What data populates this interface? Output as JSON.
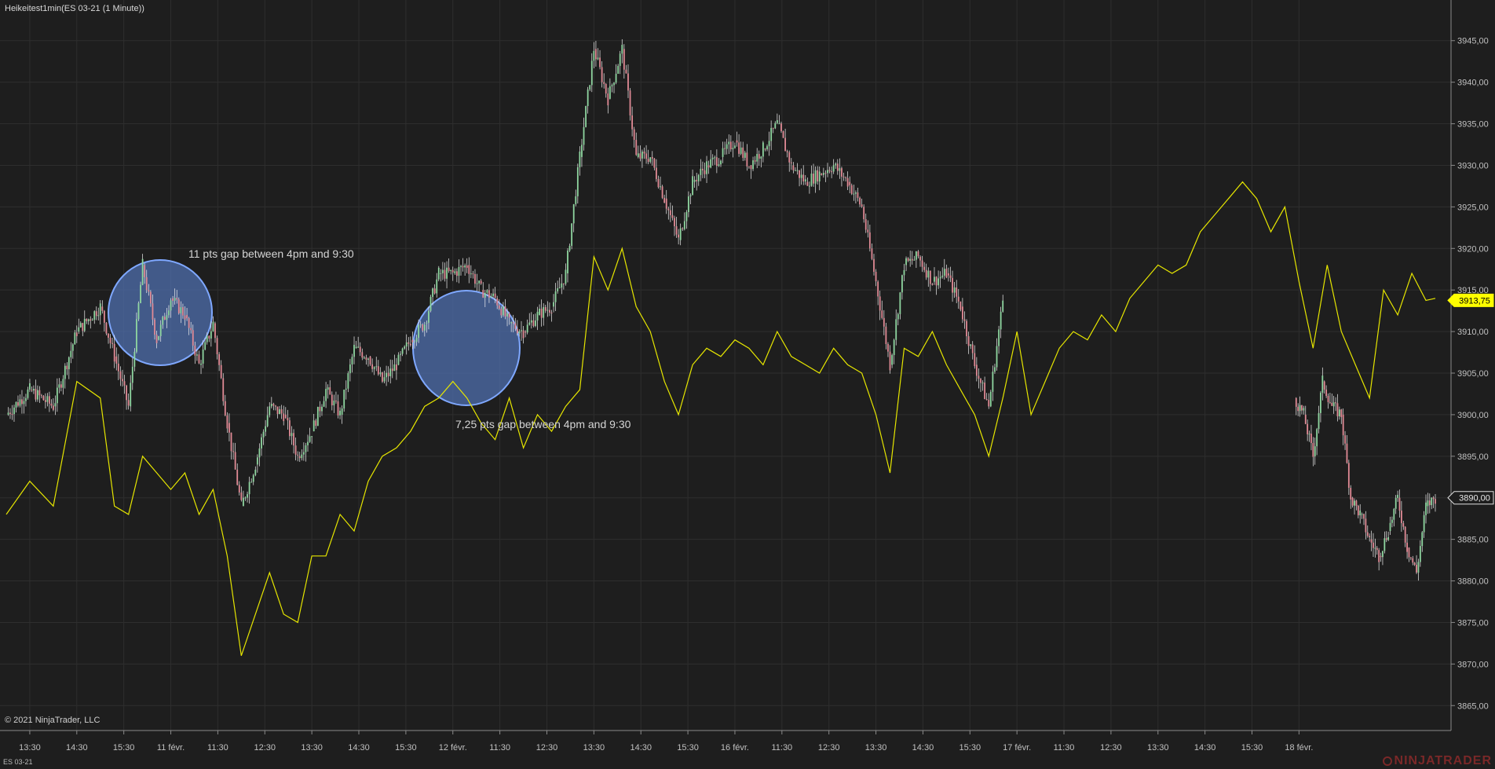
{
  "window": {
    "title": "Heikeitest1min(ES 03-21 (1 Minute))",
    "copyright": "© 2021 NinjaTrader, LLC",
    "instrument": "ES 03-21",
    "brand": "NINJATRADER",
    "brand_logo_icon": "ninjatrader-logo-icon"
  },
  "annotations": [
    "11 pts gap between 4pm and 9:30",
    "7,25 pts gap between 4pm and 9:30"
  ],
  "colors": {
    "background": "#1e1e1e",
    "grid": "#2e2e2e",
    "candle_up": "#8fd6a0",
    "candle_down": "#e08a95",
    "wick": "#f0f0f0",
    "yellow_series": "#e6e600",
    "circle_fill": "#4f6fae",
    "circle_stroke": "#7fa8ff",
    "current_price_bg": "#ffff00",
    "last_price_bg": "#1e1e1e"
  },
  "chart_data": {
    "type": "line",
    "title": "Heikeitest1min(ES 03-21 (1 Minute))",
    "ylim": [
      3862,
      3948
    ],
    "y_ticks": [
      "3945,00",
      "3940,00",
      "3935,00",
      "3930,00",
      "3925,00",
      "3920,00",
      "3915,00",
      "3910,00",
      "3905,00",
      "3900,00",
      "3895,00",
      "3890,00",
      "3885,00",
      "3880,00",
      "3875,00",
      "3870,00",
      "3865,00"
    ],
    "y_tick_values": [
      3945,
      3940,
      3935,
      3930,
      3925,
      3920,
      3915,
      3910,
      3905,
      3900,
      3895,
      3890,
      3885,
      3880,
      3875,
      3870,
      3865
    ],
    "x_ticks": [
      "13:30",
      "14:30",
      "15:30",
      "11 févr.",
      "11:30",
      "12:30",
      "13:30",
      "14:30",
      "15:30",
      "12 févr.",
      "11:30",
      "12:30",
      "13:30",
      "14:30",
      "15:30",
      "16 févr.",
      "11:30",
      "12:30",
      "13:30",
      "14:30",
      "15:30",
      "17 févr.",
      "11:30",
      "12:30",
      "13:30",
      "14:30",
      "15:30",
      "18 févr."
    ],
    "x_tick_index": [
      0.5,
      1.5,
      2.5,
      3.5,
      4.5,
      5.5,
      6.5,
      7.5,
      8.5,
      9.5,
      10.5,
      11.5,
      12.5,
      13.5,
      14.5,
      15.5,
      16.5,
      17.5,
      18.5,
      19.5,
      20.5,
      21.5,
      22.5,
      23.5,
      24.5,
      25.5,
      26.5,
      27.5
    ],
    "x_extent": 30.4,
    "price_labels": [
      {
        "label": "3913,75",
        "value": 3913.75,
        "style": "current"
      },
      {
        "label": "3890,00",
        "value": 3890.0,
        "style": "last"
      }
    ],
    "series": [
      {
        "type": "heikin-ashi",
        "segments": [
          {
            "x": [
              0,
              0.5,
              1.0,
              1.5,
              2.0,
              2.3,
              2.6,
              2.9,
              3.2,
              3.5,
              3.8,
              4.1,
              4.4,
              4.7,
              5.0,
              5.3,
              5.6,
              5.9,
              6.2,
              6.5,
              6.8,
              7.1,
              7.4,
              7.7,
              8.0,
              8.3,
              8.6,
              8.9,
              9.2,
              9.5,
              9.8,
              10.1,
              10.4,
              10.7,
              11.0,
              11.3,
              11.6,
              11.9,
              12.2,
              12.5,
              12.8,
              13.1,
              13.4,
              13.7,
              14.0,
              14.3,
              14.6,
              14.9,
              15.2,
              15.5,
              15.8,
              16.1,
              16.4,
              16.7,
              17.0,
              17.3,
              17.6,
              17.9,
              18.2,
              18.5,
              18.8,
              19.1,
              19.4,
              19.7,
              20.0,
              20.3,
              20.6,
              20.9,
              21.2
            ],
            "y": [
              3900,
              3903,
              3901,
              3910,
              3913,
              3907,
              3901,
              3918,
              3909,
              3914,
              3912,
              3906,
              3911,
              3899,
              3889,
              3894,
              3901,
              3900,
              3895,
              3898,
              3903,
              3900,
              3908,
              3907,
              3904,
              3906,
              3909,
              3911,
              3917,
              3917,
              3918,
              3915,
              3914,
              3911,
              3910,
              3912,
              3913,
              3917,
              3931,
              3944,
              3938,
              3944,
              3931,
              3931,
              3926,
              3921,
              3928,
              3930,
              3931,
              3933,
              3930,
              3932,
              3935,
              3930,
              3928,
              3929,
              3930,
              3928,
              3925,
              3916,
              3906,
              3918,
              3919,
              3916,
              3917,
              3913,
              3906,
              3901,
              3913.75
            ]
          },
          {
            "x": [
              27.4,
              27.6,
              27.8,
              28.0,
              28.2,
              28.4,
              28.6,
              28.8,
              29.0,
              29.2,
              29.4,
              29.6,
              29.8,
              30.0,
              30.2,
              30.4
            ],
            "y": [
              3902,
              3900,
              3895,
              3904,
              3901,
              3900,
              3890,
              3888,
              3885,
              3883,
              3886,
              3890,
              3884,
              3881,
              3889,
              3890
            ]
          }
        ]
      },
      {
        "type": "line",
        "x": [
          0,
          0.5,
          1.0,
          1.5,
          2.0,
          2.3,
          2.6,
          2.9,
          3.2,
          3.5,
          3.8,
          4.1,
          4.4,
          4.7,
          5.0,
          5.3,
          5.6,
          5.9,
          6.2,
          6.5,
          6.8,
          7.1,
          7.4,
          7.7,
          8.0,
          8.3,
          8.6,
          8.9,
          9.2,
          9.5,
          9.8,
          10.1,
          10.4,
          10.7,
          11.0,
          11.3,
          11.6,
          11.9,
          12.2,
          12.5,
          12.8,
          13.1,
          13.4,
          13.7,
          14.0,
          14.3,
          14.6,
          14.9,
          15.2,
          15.5,
          15.8,
          16.1,
          16.4,
          16.7,
          17.0,
          17.3,
          17.6,
          17.9,
          18.2,
          18.5,
          18.8,
          19.1,
          19.4,
          19.7,
          20.0,
          20.3,
          20.6,
          20.9,
          21.2,
          21.5,
          21.8,
          22.1,
          22.4,
          22.7,
          23.0,
          23.3,
          23.6,
          23.9,
          24.2,
          24.5,
          24.8,
          25.1,
          25.4,
          25.7,
          26.0,
          26.3,
          26.6,
          26.9,
          27.2,
          27.5,
          27.8,
          28.1,
          28.4,
          28.7,
          29.0,
          29.3,
          29.6,
          29.9,
          30.2,
          30.4
        ],
        "y": [
          3888,
          3892,
          3889,
          3904,
          3902,
          3889,
          3888,
          3895,
          3893,
          3891,
          3893,
          3888,
          3891,
          3883,
          3871,
          3876,
          3881,
          3876,
          3875,
          3883,
          3883,
          3888,
          3886,
          3892,
          3895,
          3896,
          3898,
          3901,
          3902,
          3904,
          3902,
          3899,
          3897,
          3902,
          3896,
          3900,
          3898,
          3901,
          3903,
          3919,
          3915,
          3920,
          3913,
          3910,
          3904,
          3900,
          3906,
          3908,
          3907,
          3909,
          3908,
          3906,
          3910,
          3907,
          3906,
          3905,
          3908,
          3906,
          3905,
          3900,
          3893,
          3908,
          3907,
          3910,
          3906,
          3903,
          3900,
          3895,
          3902,
          3910,
          3900,
          3904,
          3908,
          3910,
          3909,
          3912,
          3910,
          3914,
          3916,
          3918,
          3917,
          3918,
          3922,
          3924,
          3926,
          3928,
          3926,
          3922,
          3925,
          3916,
          3908,
          3918,
          3910,
          3906,
          3902,
          3915,
          3912,
          3917,
          3913.75,
          3914
        ]
      }
    ]
  }
}
